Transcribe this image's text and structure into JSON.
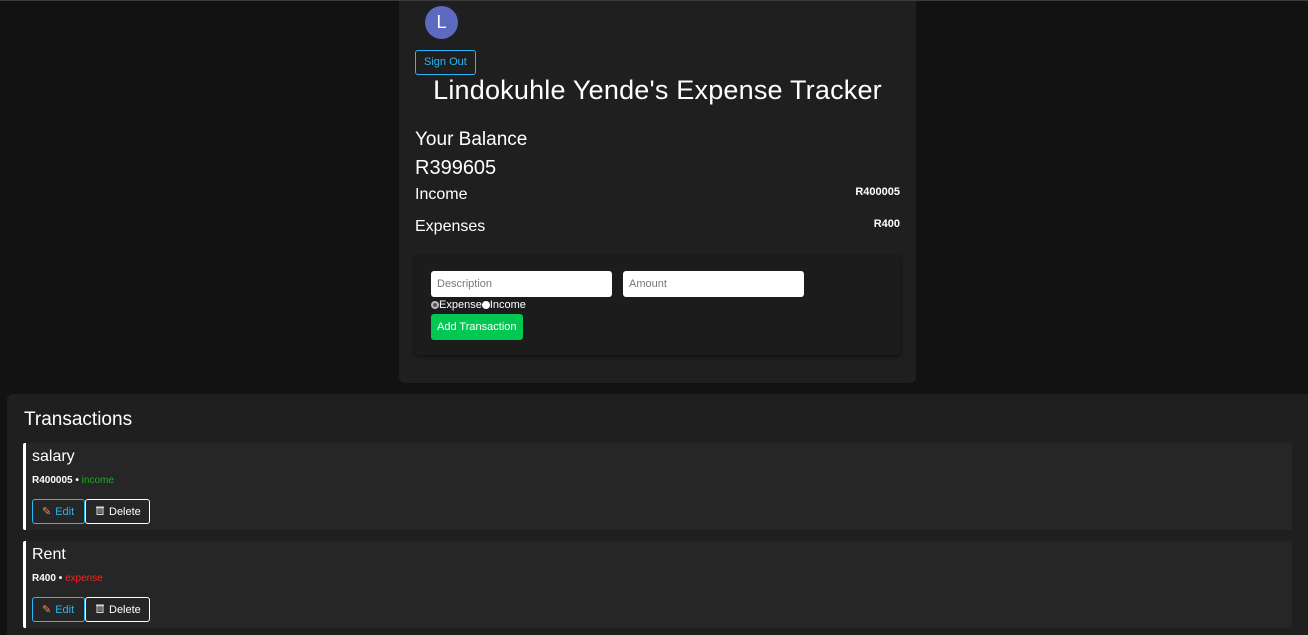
{
  "user": {
    "avatar_initial": "L",
    "signout_label": "Sign Out"
  },
  "app": {
    "title": "Lindokuhle Yende's Expense Tracker"
  },
  "summary": {
    "balance_label": "Your Balance",
    "balance_value": "R399605",
    "income_label": "Income",
    "income_value": "R400005",
    "expenses_label": "Expenses",
    "expenses_value": "R400"
  },
  "form": {
    "description_placeholder": "Description",
    "amount_placeholder": "Amount",
    "radio_expense_label": "Expense",
    "radio_income_label": "Income",
    "selected_type": "expense",
    "add_button_label": "Add Transaction"
  },
  "transactions": {
    "title": "Transactions",
    "items": [
      {
        "name": "salary",
        "amount": "R400005",
        "separator": "•",
        "type": "income",
        "edit_label": "Edit",
        "delete_label": "Delete"
      },
      {
        "name": "Rent",
        "amount": "R400",
        "separator": "•",
        "type": "expense",
        "edit_label": "Edit",
        "delete_label": "Delete"
      }
    ]
  },
  "colors": {
    "accent": "#29b6f6",
    "add_button": "#00c853",
    "income": "#1faa1f",
    "expense": "#ff1f1f",
    "avatar": "#5c6bc0"
  },
  "icons": {
    "edit": "pencil-icon",
    "delete": "trash-icon"
  }
}
